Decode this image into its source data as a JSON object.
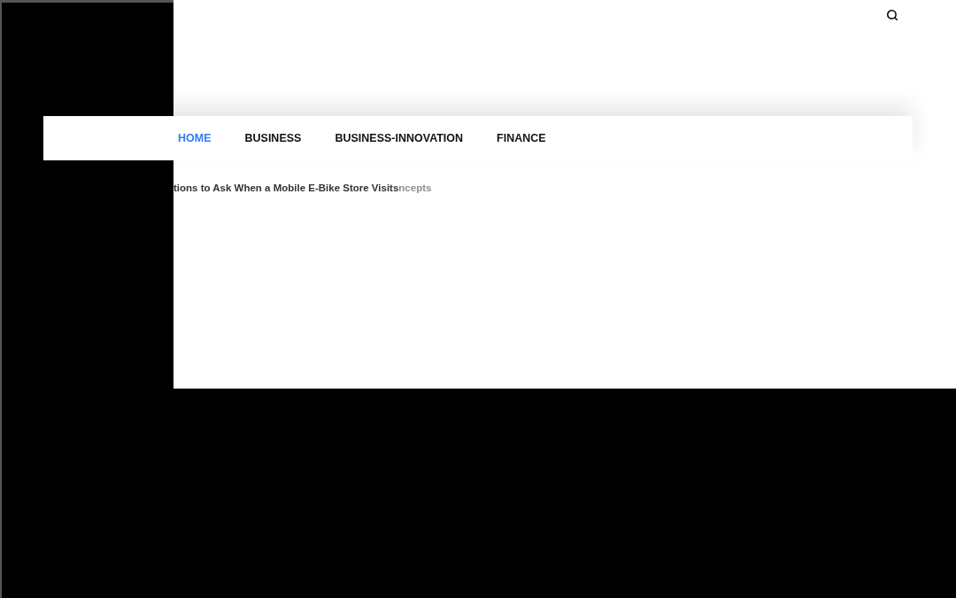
{
  "nav": {
    "items": [
      {
        "label": "HOME",
        "selected": true
      },
      {
        "label": "BUSINESS",
        "selected": false
      },
      {
        "label": "BUSINESS-INNOVATION",
        "selected": false
      },
      {
        "label": "FINANCE",
        "selected": false
      }
    ]
  },
  "ticker": {
    "headline": "tions to Ask When a Mobile E-Bike Store Visits",
    "faded_headline": "ncepts"
  }
}
